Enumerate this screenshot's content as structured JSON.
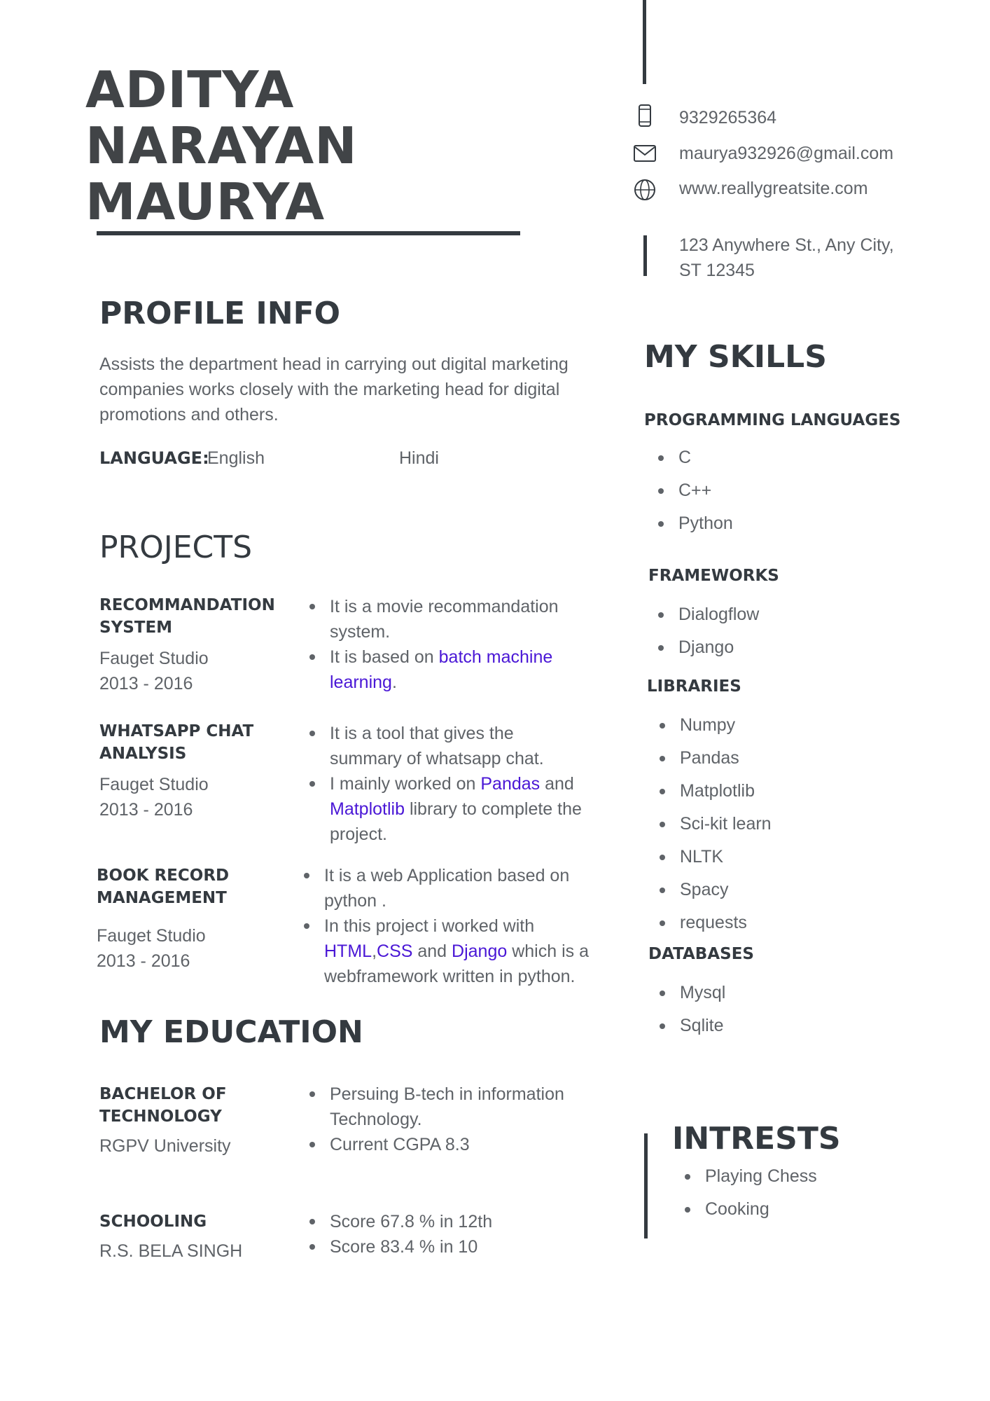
{
  "header": {
    "name": "ADITYA NARAYAN MAURYA"
  },
  "contact": {
    "phone": "9329265364",
    "email": "maurya932926@gmail.com",
    "website": "www.reallygreatsite.com",
    "address": "123 Anywhere St., Any City, ST 12345",
    "icons": [
      "phone-icon",
      "mail-icon",
      "globe-icon"
    ]
  },
  "profile": {
    "heading": "PROFILE INFO",
    "text": "Assists the department head in carrying out digital marketing companies works closely with the marketing head for digital promotions and others.",
    "language_label": "LANGUAGE:",
    "languages": [
      "English",
      "Hindi"
    ]
  },
  "projects": {
    "heading": "PROJECTS",
    "items": [
      {
        "title": "RECOMMANDATION SYSTEM",
        "studio": "Fauget Studio",
        "years": "2013 - 2016",
        "b1": "It is a movie recommandation system.",
        "b2_pre": "It is based on ",
        "b2_link": "batch machine learning",
        "b2_post": "."
      },
      {
        "title": "WHATSAPP CHAT ANALYSIS",
        "studio": "Fauget Studio",
        "years": "2013 - 2016",
        "b1": "It is a tool that gives the summary of whatsapp chat.",
        "b2_pre": "I mainly worked on ",
        "b2_link1": "Pandas",
        "b2_mid": " and ",
        "b2_link2": "Matplotlib",
        "b2_post": " library to complete the project."
      },
      {
        "title": "BOOK RECORD MANAGEMENT",
        "studio": "Fauget Studio",
        "years": "2013 - 2016",
        "b1": "It is a web Application based on python .",
        "b2_pre": "In this project i worked with ",
        "b2_link1": "HTML",
        "b2_sep": ",",
        "b2_link2": "CSS",
        "b2_mid": " and ",
        "b2_link3": "Django",
        "b2_post": " which is a webframework written in python."
      }
    ]
  },
  "education": {
    "heading": "MY EDUCATION",
    "items": [
      {
        "title": "BACHELOR OF TECHNOLOGY",
        "org": "RGPV University",
        "bullets": [
          "Persuing B-tech in information Technology.",
          "Current CGPA 8.3"
        ]
      },
      {
        "title": "SCHOOLING",
        "org": "R.S. BELA SINGH",
        "bullets": [
          "Score 67.8 % in 12th",
          "Score 83.4 % in 10"
        ]
      }
    ]
  },
  "skills": {
    "heading": "MY SKILLS",
    "programming": {
      "label": "PROGRAMMING LANGUAGES",
      "items": [
        "C",
        "C++",
        "Python"
      ]
    },
    "frameworks": {
      "label": "FRAMEWORKS",
      "items": [
        "Dialogflow",
        "Django"
      ]
    },
    "libraries": {
      "label": "LIBRARIES",
      "items": [
        "Numpy",
        "Pandas",
        "Matplotlib",
        "Sci-kit learn",
        "NLTK",
        "Spacy",
        "requests"
      ]
    },
    "databases": {
      "label": "DATABASES",
      "items": [
        "Mysql",
        "Sqlite"
      ]
    }
  },
  "interests": {
    "heading": "INTRESTS",
    "items": [
      "Playing Chess",
      "Cooking"
    ]
  },
  "colors": {
    "text": "#5f6368",
    "heading": "#343a40",
    "link": "#4a17d6"
  }
}
